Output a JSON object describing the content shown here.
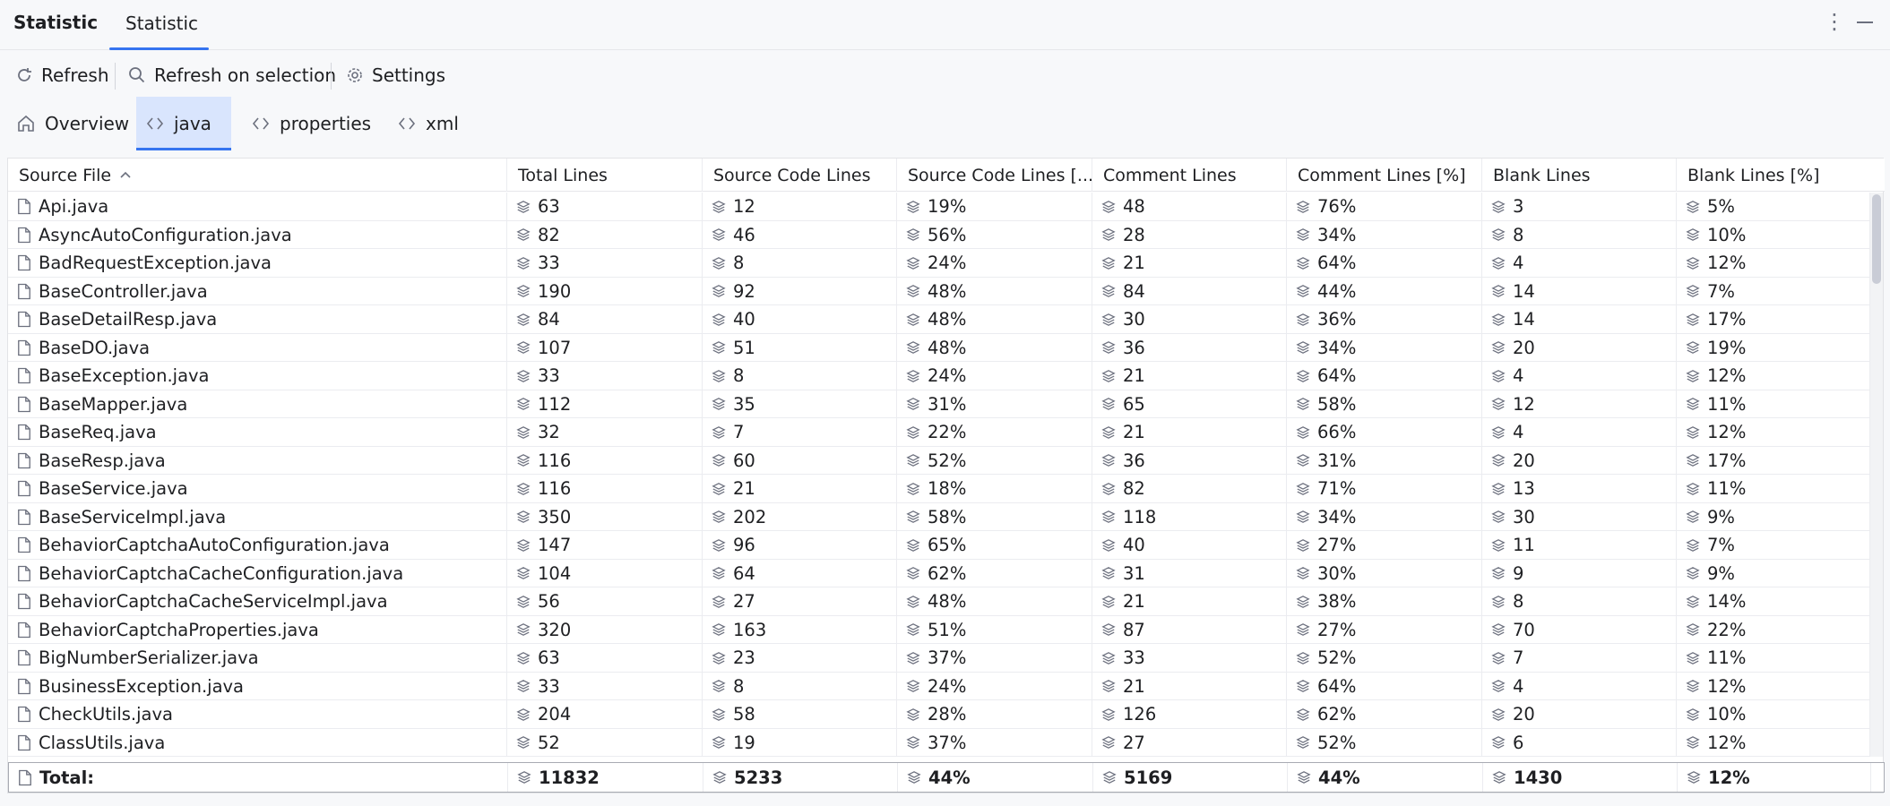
{
  "header": {
    "app_title": "Statistic",
    "tab_label": "Statistic",
    "more_icon": "more-vertical-icon",
    "minimize_icon": "minimize-icon"
  },
  "toolbar": {
    "refresh_label": "Refresh",
    "refresh_on_selection_label": "Refresh on selection",
    "settings_label": "Settings"
  },
  "subtabs": [
    {
      "label": "Overview",
      "icon": "home-icon"
    },
    {
      "label": "java",
      "icon": "code-icon"
    },
    {
      "label": "properties",
      "icon": "code-icon"
    },
    {
      "label": "xml",
      "icon": "code-icon"
    }
  ],
  "columns": [
    "Source File",
    "Total Lines",
    "Source Code Lines",
    "Source Code Lines [...",
    "Comment Lines",
    "Comment Lines [%]",
    "Blank Lines",
    "Blank Lines [%]"
  ],
  "sort_indicator": "sort-ascending-icon",
  "rows": [
    [
      "Api.java",
      "63",
      "12",
      "19%",
      "48",
      "76%",
      "3",
      "5%"
    ],
    [
      "AsyncAutoConfiguration.java",
      "82",
      "46",
      "56%",
      "28",
      "34%",
      "8",
      "10%"
    ],
    [
      "BadRequestException.java",
      "33",
      "8",
      "24%",
      "21",
      "64%",
      "4",
      "12%"
    ],
    [
      "BaseController.java",
      "190",
      "92",
      "48%",
      "84",
      "44%",
      "14",
      "7%"
    ],
    [
      "BaseDetailResp.java",
      "84",
      "40",
      "48%",
      "30",
      "36%",
      "14",
      "17%"
    ],
    [
      "BaseDO.java",
      "107",
      "51",
      "48%",
      "36",
      "34%",
      "20",
      "19%"
    ],
    [
      "BaseException.java",
      "33",
      "8",
      "24%",
      "21",
      "64%",
      "4",
      "12%"
    ],
    [
      "BaseMapper.java",
      "112",
      "35",
      "31%",
      "65",
      "58%",
      "12",
      "11%"
    ],
    [
      "BaseReq.java",
      "32",
      "7",
      "22%",
      "21",
      "66%",
      "4",
      "12%"
    ],
    [
      "BaseResp.java",
      "116",
      "60",
      "52%",
      "36",
      "31%",
      "20",
      "17%"
    ],
    [
      "BaseService.java",
      "116",
      "21",
      "18%",
      "82",
      "71%",
      "13",
      "11%"
    ],
    [
      "BaseServiceImpl.java",
      "350",
      "202",
      "58%",
      "118",
      "34%",
      "30",
      "9%"
    ],
    [
      "BehaviorCaptchaAutoConfiguration.java",
      "147",
      "96",
      "65%",
      "40",
      "27%",
      "11",
      "7%"
    ],
    [
      "BehaviorCaptchaCacheConfiguration.java",
      "104",
      "64",
      "62%",
      "31",
      "30%",
      "9",
      "9%"
    ],
    [
      "BehaviorCaptchaCacheServiceImpl.java",
      "56",
      "27",
      "48%",
      "21",
      "38%",
      "8",
      "14%"
    ],
    [
      "BehaviorCaptchaProperties.java",
      "320",
      "163",
      "51%",
      "87",
      "27%",
      "70",
      "22%"
    ],
    [
      "BigNumberSerializer.java",
      "63",
      "23",
      "37%",
      "33",
      "52%",
      "7",
      "11%"
    ],
    [
      "BusinessException.java",
      "33",
      "8",
      "24%",
      "21",
      "64%",
      "4",
      "12%"
    ],
    [
      "CheckUtils.java",
      "204",
      "58",
      "28%",
      "126",
      "62%",
      "20",
      "10%"
    ],
    [
      "ClassUtils.java",
      "52",
      "19",
      "37%",
      "27",
      "52%",
      "6",
      "12%"
    ]
  ],
  "total": [
    "Total:",
    "11832",
    "5233",
    "44%",
    "5169",
    "44%",
    "1430",
    "12%"
  ]
}
